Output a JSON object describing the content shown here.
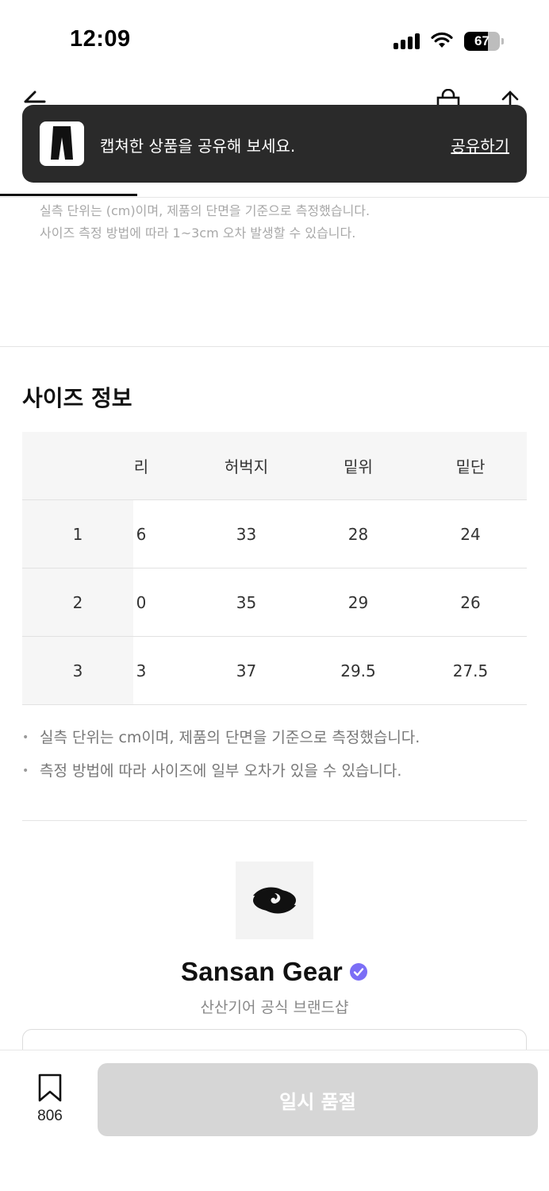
{
  "status_bar": {
    "time": "12:09",
    "battery": "67",
    "battery_level": 0.67
  },
  "header": {
    "icons": [
      "back-icon",
      "shopping-bag-icon",
      "share-icon"
    ]
  },
  "toast": {
    "message": "캡쳐한 상품을 공유해 보세요.",
    "action": "공유하기"
  },
  "measure_notice": {
    "line1": "실측 단위는 (cm)이며, 제품의 단면을 기준으로 측정했습니다.",
    "line2": "사이즈 측정 방법에 따라 1~3cm 오차 발생할 수 있습니다."
  },
  "size_info": {
    "title": "사이즈 정보",
    "headers": [
      "",
      "리",
      "허벅지",
      "밑위",
      "밑단"
    ],
    "rows": [
      [
        "1",
        "6",
        "33",
        "28",
        "24"
      ],
      [
        "2",
        "0",
        "35",
        "29",
        "26"
      ],
      [
        "3",
        "3",
        "37",
        "29.5",
        "27.5"
      ]
    ],
    "notes": [
      "실측 단위는 cm이며, 제품의 단면을 기준으로 측정했습니다.",
      "측정 방법에 따라 사이즈에 일부 오차가 있을 수 있습니다."
    ]
  },
  "brand": {
    "name": "Sansan Gear",
    "description": "산산기어 공식 브랜드샵",
    "verified_color": "#7b6ef6"
  },
  "bottom_bar": {
    "wish_count": "806",
    "soldout_label": "일시 품절"
  }
}
